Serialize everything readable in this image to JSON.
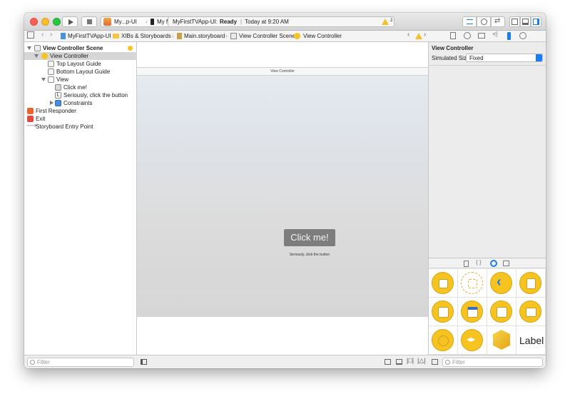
{
  "toolbar": {
    "scheme_target": "My...p-UI",
    "device": "My Mac",
    "status_project": "MyFirstTVApp-UI:",
    "status_state": "Ready",
    "status_time": "Today at 9:20 AM",
    "warning_count": "2"
  },
  "jumpbar": {
    "crumbs": [
      "MyFirstTVApp-UI",
      "XIBs & Storyboards",
      "Main.storyboard",
      "View Controller Scene",
      "View Controller"
    ]
  },
  "navigator": {
    "items": [
      {
        "label": "View Controller Scene"
      },
      {
        "label": "View Controller"
      },
      {
        "label": "Top Layout Guide"
      },
      {
        "label": "Bottom Layout Guide"
      },
      {
        "label": "View"
      },
      {
        "label": "Click me!"
      },
      {
        "label": "Seriously, click the button"
      },
      {
        "label": "Constraints"
      },
      {
        "label": "First Responder"
      },
      {
        "label": "Exit"
      },
      {
        "label": "Storyboard Entry Point"
      }
    ],
    "filter_placeholder": "Filter"
  },
  "canvas": {
    "scene_title": "View Controller",
    "button_label": "Click me!",
    "label_text": "Seriously, click the button"
  },
  "inspector": {
    "header": "View Controller",
    "simulated_size_label": "Simulated Size",
    "simulated_size_value": "Fixed",
    "library_label_item": "Label",
    "filter_placeholder": "Filter"
  },
  "colors": {
    "accent": "#1b7cf2",
    "selection": "#d6d6d6",
    "library_yellow": "#f7c320",
    "warning": "#f5c028"
  }
}
